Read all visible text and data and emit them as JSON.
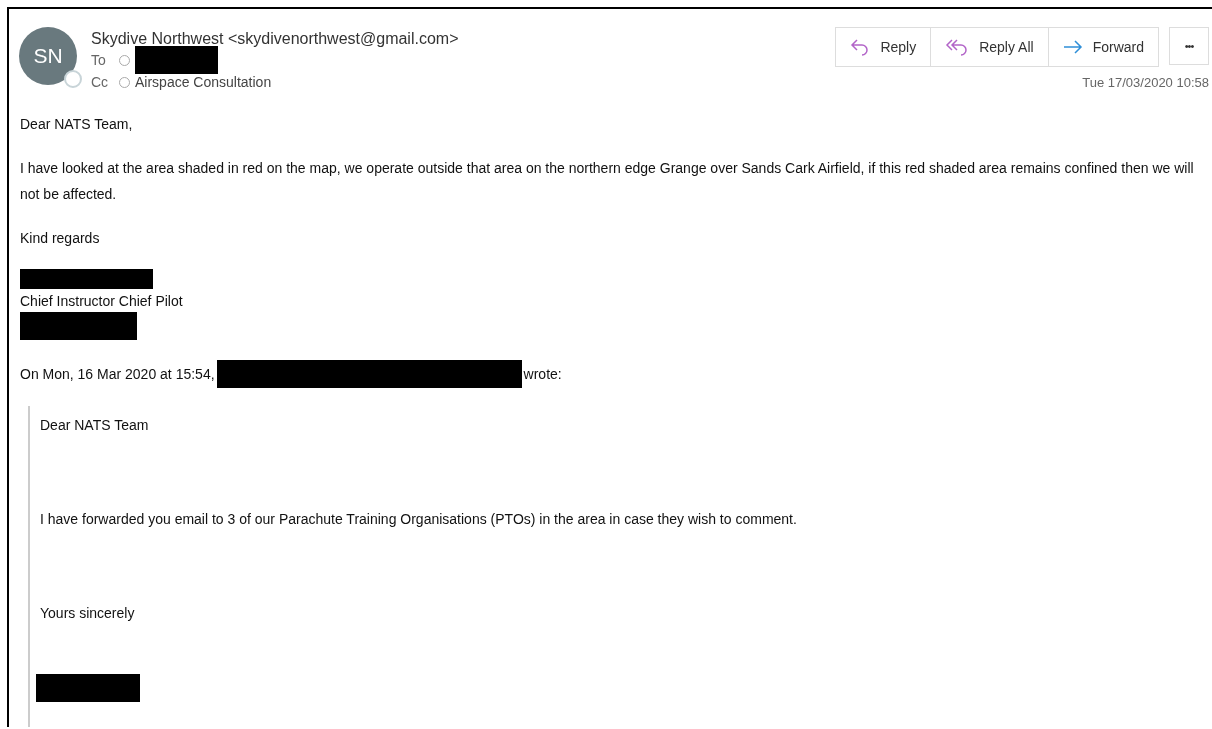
{
  "message": {
    "avatar": {
      "initials": "SN",
      "online": false
    },
    "sender": "Skydive Northwest <skydivenorthwest@gmail.com>",
    "recipients": [
      {
        "label": "To",
        "redacted": true
      },
      {
        "label": "Cc",
        "name": "Airspace Consultation",
        "redacted": false
      }
    ],
    "actions": [
      {
        "kind": "reply",
        "label": "Reply"
      },
      {
        "kind": "reply-all",
        "label": "Reply All"
      },
      {
        "kind": "forward",
        "label": "Forward"
      },
      {
        "kind": "more",
        "label": "•••"
      }
    ],
    "date": "Tue 17/03/2020 10:58"
  },
  "body": [
    {
      "kind": "text",
      "text": "Dear NATS Team,"
    },
    {
      "kind": "text",
      "text": "I have looked at the area shaded in red on the map, we operate outside that area on the northern edge Grange over Sands Cark Airfield, if this red shaded area remains confined then we will not be affected."
    },
    {
      "kind": "text",
      "text": "Kind regards"
    },
    {
      "kind": "signature",
      "lines": [
        {
          "kind": "redaction"
        },
        {
          "kind": "text",
          "text": "Chief Instructor Chief Pilot"
        },
        {
          "kind": "redaction"
        }
      ]
    },
    {
      "kind": "attribution",
      "before": "On Mon, 16 Mar 2020 at 15:54,",
      "after": "wrote:"
    },
    {
      "kind": "quote",
      "blocks": [
        {
          "kind": "text",
          "text": "Dear NATS Team"
        },
        {
          "kind": "text",
          "text": "I have forwarded you email to 3 of our Parachute Training Organisations (PTOs) in the area in case they wish to comment."
        },
        {
          "kind": "text",
          "text": "Yours sincerely"
        },
        {
          "kind": "redaction"
        }
      ]
    }
  ]
}
